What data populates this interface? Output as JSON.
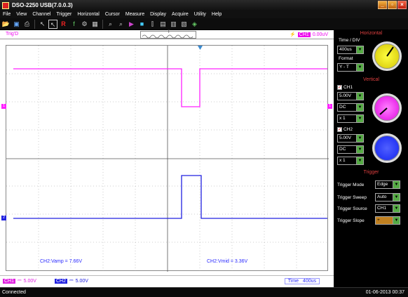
{
  "window": {
    "title": "DSO-2250 USB(7.0.0.3)"
  },
  "menu": [
    "File",
    "View",
    "Channel",
    "Trigger",
    "Horizontal",
    "Cursor",
    "Measure",
    "Display",
    "Acquire",
    "Utility",
    "Help"
  ],
  "trigger_bar": {
    "label": "Trig'D",
    "channel": "CH1",
    "level": "0.00uV"
  },
  "measurements": {
    "left": "CH2:Vamp = 7.66V",
    "right": "CH2:Vmid = 3.36V"
  },
  "channel_bar": {
    "ch1": {
      "tag": "CH1",
      "value": "5.00V",
      "color": "#e020e0"
    },
    "ch2": {
      "tag": "CH2",
      "value": "5.00V",
      "color": "#2020e0"
    },
    "time_label": "Time",
    "time_value": "400us"
  },
  "status": {
    "left": "Connected",
    "right": "01-06-2013  00:37"
  },
  "panel": {
    "horizontal": {
      "header": "Horizontal",
      "time_div_label": "Time / DIV",
      "time_div": "400us",
      "format_label": "Format",
      "format": "Y - T"
    },
    "vertical": {
      "header": "Vertical",
      "ch1": {
        "label": "CH1",
        "volts": "5.00V",
        "coupling": "DC",
        "probe": "x 1",
        "color": "#ff40ff"
      },
      "ch2": {
        "label": "CH2",
        "volts": "5.00V",
        "coupling": "DC",
        "probe": "x 1",
        "color": "#2030ff"
      }
    },
    "trigger": {
      "header": "Trigger",
      "mode_label": "Trigger Mode",
      "mode": "Edge",
      "sweep_label": "Trigger Sweep",
      "sweep": "Auto",
      "source_label": "Trigger Source",
      "source": "CH1",
      "slope_label": "Trigger Slope",
      "slope": "+"
    }
  },
  "markers": {
    "ch1": "1",
    "ch2": "2",
    "trigger_pos": "T"
  }
}
